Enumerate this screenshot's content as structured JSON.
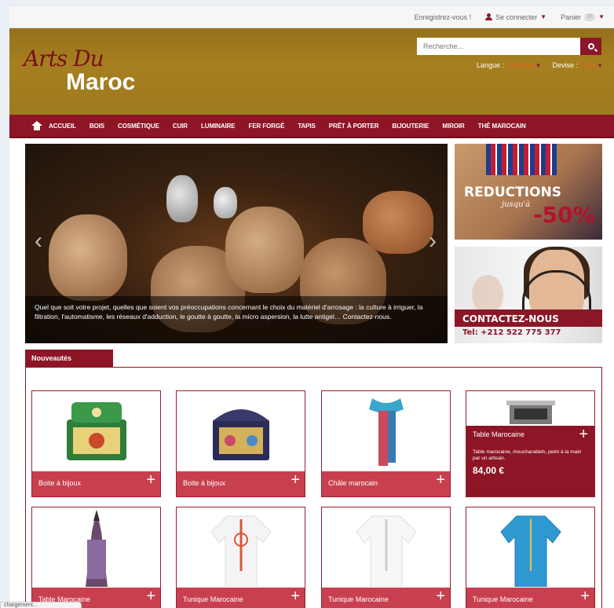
{
  "topbar": {
    "register": "Enregistrez-vous !",
    "login": "Se connecter",
    "cart": "Panier",
    "cart_count": "0"
  },
  "header": {
    "logo_script": "Arts Du",
    "logo_main": "Maroc",
    "search_placeholder": "Recherche...",
    "lang_label": "Langue :",
    "lang_value": "Français",
    "currency_label": "Devise :",
    "currency_value": "EUR"
  },
  "nav": {
    "items": [
      "Accueil",
      "Bois",
      "Cosmétique",
      "Cuir",
      "Luminaire",
      "Fer forgé",
      "Tapis",
      "Prêt à porter",
      "Bijouterie",
      "Miroir",
      "Thé marocain"
    ]
  },
  "slider": {
    "caption": "Quel que soit votre projet, quelles que soient vos préoccupations concernant le choix du matériel d'arrosage : la culture à irriguer, la filtration, l'automatisme, les réseaux d'adduction, le goutte à goutte, la micro aspersion, la lutte antigel… Contactez-nous."
  },
  "promos": {
    "reductions": "REDUCTIONS",
    "jusqua": "jusqu'à",
    "percent": "-50%",
    "contact": "CONTACTEZ-NOUS",
    "tel": "Tel: +212 522 775 377"
  },
  "nouveautes": {
    "title": "Nouveautés",
    "products": [
      {
        "name": "Boite à bijoux"
      },
      {
        "name": "Boite à bijoux"
      },
      {
        "name": "Châle marocain"
      },
      {
        "name": "Table Marocaine",
        "desc": "Table marocaine, moucharabieh, peint à la main par un artisan.",
        "price": "84,00 €"
      },
      {
        "name": "Table Marocaine"
      },
      {
        "name": "Tunique Marocaine"
      },
      {
        "name": "Tunique Marocaine"
      },
      {
        "name": "Tunique Marocaine"
      }
    ]
  },
  "statusbar": "chargement..."
}
